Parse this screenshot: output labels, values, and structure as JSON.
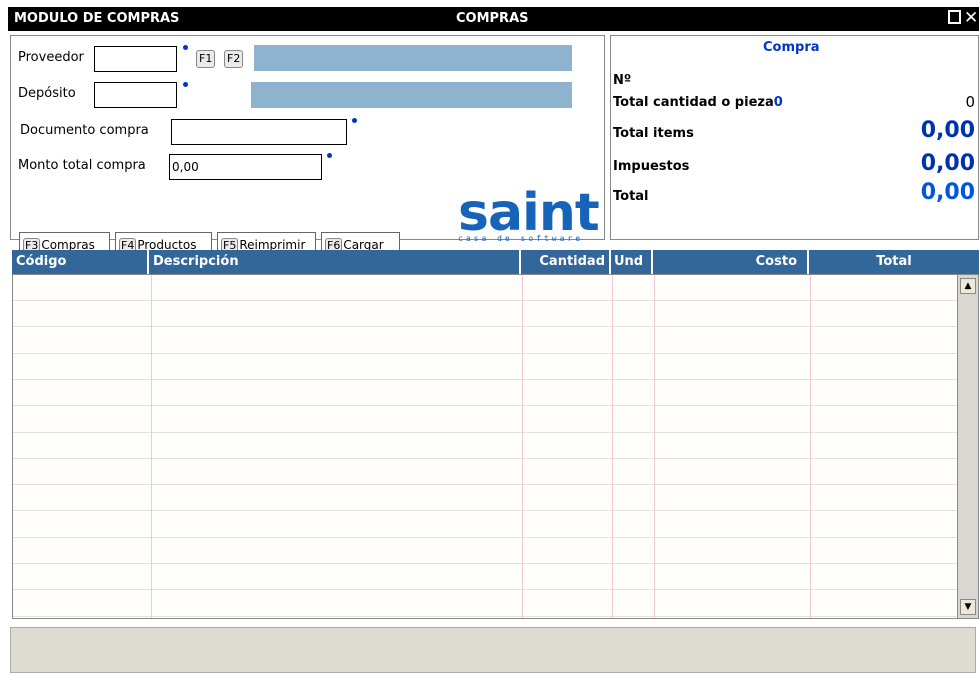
{
  "window": {
    "module_title": "MODULO DE COMPRAS",
    "center_title": "COMPRAS"
  },
  "form": {
    "proveedor_label": "Proveedor",
    "proveedor_value": "",
    "f1_label": "F1",
    "f2_label": "F2",
    "deposito_label": "Depósito",
    "deposito_value": "",
    "documento_label": "Documento compra",
    "documento_value": "",
    "monto_label": "Monto total compra",
    "monto_value": "0,00"
  },
  "buttons": [
    {
      "key": "F3",
      "label": "Compras"
    },
    {
      "key": "F4",
      "label": "Productos"
    },
    {
      "key": "F5",
      "label": "Reimprimir"
    },
    {
      "key": "F6",
      "label": "Cargar"
    }
  ],
  "logo": {
    "word": "saint",
    "tagline": "casa de software"
  },
  "summary": {
    "title": "Compra",
    "numero_label": "Nº",
    "cantidad_label": "Total cantidad o pieza",
    "cantidad_inline": "0",
    "cantidad_value": "0",
    "items_label": "Total items",
    "items_value": "0,00",
    "impuestos_label": "Impuestos",
    "impuestos_value": "0,00",
    "total_label": "Total",
    "total_value": "0,00"
  },
  "grid": {
    "columns": [
      "Código",
      "Descripción",
      "Cantidad",
      "Und",
      "Costo",
      "Total"
    ]
  },
  "colors": {
    "header_bg": "#336699",
    "accent_blue": "#0033cc",
    "logo_blue": "#1763b8"
  }
}
